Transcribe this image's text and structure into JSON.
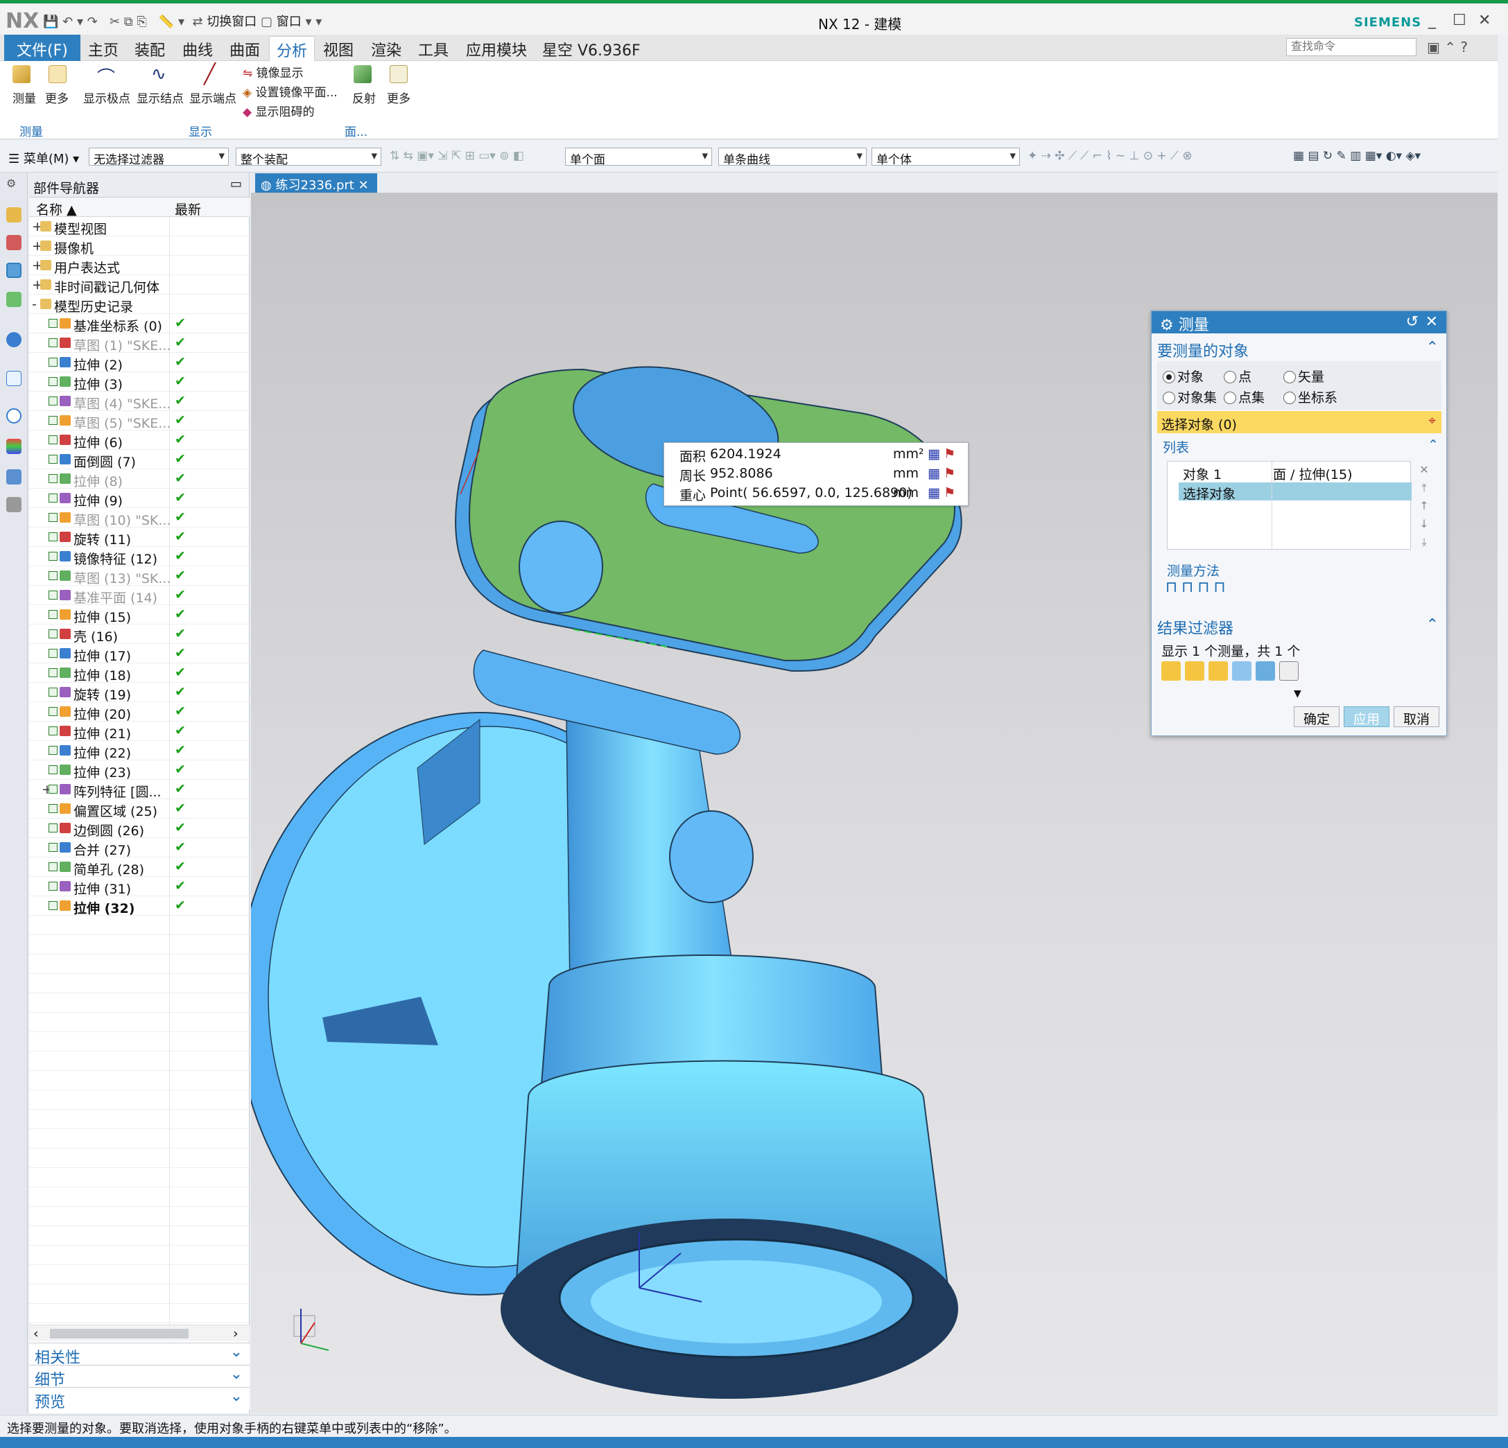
{
  "titlebar": {
    "logo": "NX",
    "switch_window": "切换窗口",
    "window": "窗口",
    "title": "NX 12 - 建模",
    "brand": "SIEMENS"
  },
  "menu": {
    "file": "文件(F)",
    "tabs": [
      "主页",
      "装配",
      "曲线",
      "曲面",
      "分析",
      "视图",
      "渲染",
      "工具",
      "应用模块",
      "星空 V6.936F"
    ],
    "active": "分析",
    "search_placeholder": "查找命令"
  },
  "ribbon": {
    "measure": "测量",
    "more1": "更多",
    "show_poles": "显示极点",
    "show_knots": "显示结点",
    "show_ends": "显示端点",
    "mirror_display": "镜像显示",
    "set_mirror_plane": "设置镜像平面...",
    "show_blocking": "显示阻碍的",
    "reflection": "反射",
    "more2": "更多",
    "group_measure": "测量",
    "group_display": "显示",
    "group_face": "面..."
  },
  "filterbar": {
    "menu": "菜单(M)",
    "filter": "无选择过滤器",
    "assembly": "整个装配",
    "face": "单个面",
    "curve": "单条曲线",
    "body": "单个体"
  },
  "nav": {
    "title": "部件导航器",
    "col_name": "名称",
    "col_latest": "最新",
    "items": [
      {
        "label": "模型视图",
        "indent": 0,
        "expand": "+"
      },
      {
        "label": "摄像机",
        "indent": 0,
        "expand": "+"
      },
      {
        "label": "用户表达式",
        "indent": 0,
        "expand": "+"
      },
      {
        "label": "非时间戳记几何体",
        "indent": 0,
        "expand": "+"
      },
      {
        "label": "模型历史记录",
        "indent": 0,
        "expand": "-"
      },
      {
        "label": "基准坐标系 (0)",
        "indent": 1,
        "latest": "✔"
      },
      {
        "label": "草图 (1) \"SKE...",
        "indent": 1,
        "latest": "✔",
        "dim": true
      },
      {
        "label": "拉伸 (2)",
        "indent": 1,
        "latest": "✔"
      },
      {
        "label": "拉伸 (3)",
        "indent": 1,
        "latest": "✔"
      },
      {
        "label": "草图 (4) \"SKE...",
        "indent": 1,
        "latest": "✔",
        "dim": true
      },
      {
        "label": "草图 (5) \"SKE...",
        "indent": 1,
        "latest": "✔",
        "dim": true
      },
      {
        "label": "拉伸 (6)",
        "indent": 1,
        "latest": "✔"
      },
      {
        "label": "面倒圆 (7)",
        "indent": 1,
        "latest": "✔"
      },
      {
        "label": "拉伸 (8)",
        "indent": 1,
        "latest": "✔",
        "dim": true
      },
      {
        "label": "拉伸 (9)",
        "indent": 1,
        "latest": "✔"
      },
      {
        "label": "草图 (10) \"SK...",
        "indent": 1,
        "latest": "✔",
        "dim": true
      },
      {
        "label": "旋转 (11)",
        "indent": 1,
        "latest": "✔"
      },
      {
        "label": "镜像特征 (12)",
        "indent": 1,
        "latest": "✔"
      },
      {
        "label": "草图 (13) \"SK...",
        "indent": 1,
        "latest": "✔",
        "dim": true
      },
      {
        "label": "基准平面 (14)",
        "indent": 1,
        "latest": "✔",
        "dim": true
      },
      {
        "label": "拉伸 (15)",
        "indent": 1,
        "latest": "✔"
      },
      {
        "label": "壳 (16)",
        "indent": 1,
        "latest": "✔"
      },
      {
        "label": "拉伸 (17)",
        "indent": 1,
        "latest": "✔"
      },
      {
        "label": "拉伸 (18)",
        "indent": 1,
        "latest": "✔"
      },
      {
        "label": "旋转 (19)",
        "indent": 1,
        "latest": "✔"
      },
      {
        "label": "拉伸 (20)",
        "indent": 1,
        "latest": "✔"
      },
      {
        "label": "拉伸 (21)",
        "indent": 1,
        "latest": "✔"
      },
      {
        "label": "拉伸 (22)",
        "indent": 1,
        "latest": "✔"
      },
      {
        "label": "拉伸 (23)",
        "indent": 1,
        "latest": "✔"
      },
      {
        "label": "阵列特征 [圆...",
        "indent": 1,
        "latest": "✔",
        "expand": "+"
      },
      {
        "label": "偏置区域 (25)",
        "indent": 1,
        "latest": "✔"
      },
      {
        "label": "边倒圆 (26)",
        "indent": 1,
        "latest": "✔"
      },
      {
        "label": "合并 (27)",
        "indent": 1,
        "latest": "✔"
      },
      {
        "label": "简单孔 (28)",
        "indent": 1,
        "latest": "✔"
      },
      {
        "label": "拉伸 (31)",
        "indent": 1,
        "latest": "✔"
      },
      {
        "label": "拉伸 (32)",
        "indent": 1,
        "latest": "✔",
        "bold": true
      }
    ],
    "sections": [
      "相关性",
      "细节",
      "预览"
    ]
  },
  "viewport": {
    "tab": "练习2336.prt"
  },
  "measure_popup": {
    "rows": [
      {
        "label": "面积",
        "value": "6204.1924",
        "unit": "mm²"
      },
      {
        "label": "周长",
        "value": "952.8086",
        "unit": "mm"
      },
      {
        "label": "重心",
        "value": "Point( 56.6597, 0.0, 125.6890)",
        "unit": "mm"
      }
    ]
  },
  "dialog": {
    "title": "测量",
    "sec_objects": "要测量的对象",
    "radios": [
      "对象",
      "点",
      "矢量",
      "对象集",
      "点集",
      "坐标系"
    ],
    "selected_radio": "对象",
    "select_object": "选择对象 (0)",
    "list_title": "列表",
    "list_rows": [
      {
        "c1": "对象 1",
        "c2": "面 / 拉伸(15)"
      },
      {
        "c1": "选择对象",
        "c2": ""
      }
    ],
    "method": "测量方法",
    "filter_title": "结果过滤器",
    "filter_text": "显示 1 个测量，共 1 个",
    "ok": "确定",
    "apply": "应用",
    "cancel": "取消"
  },
  "status": "选择要测量的对象。要取消选择，使用对象手柄的右键菜单中或列表中的“移除”。",
  "colors": {
    "accent": "#2e7fbf",
    "model": "#62bdfb",
    "face": "#72b764",
    "check": "#1aa01a"
  }
}
